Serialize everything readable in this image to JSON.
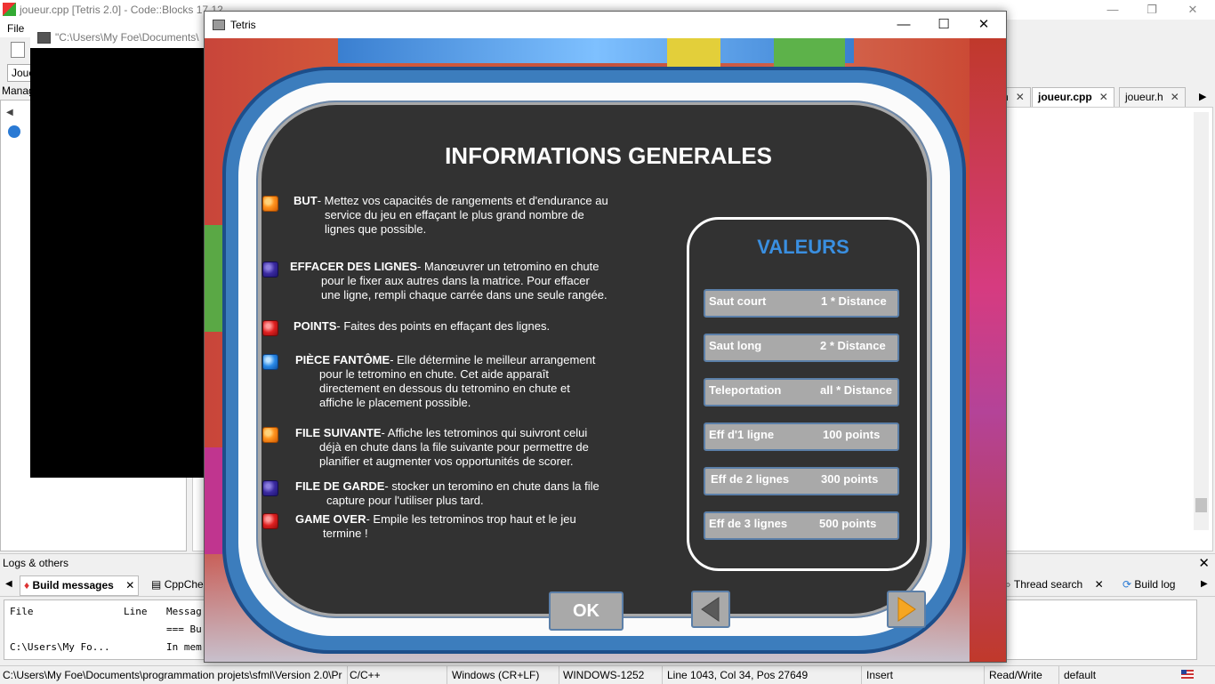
{
  "codeblocks": {
    "window_title": "joueur.cpp [Tetris 2.0] - Code::Blocks 17.12",
    "menu_file": "File",
    "manager_label": "Manag",
    "toolbar2_label": "Joue",
    "tabs": [
      {
        "label": "n"
      },
      {
        "label": "joueur.cpp"
      },
      {
        "label": "joueur.h"
      }
    ],
    "logs_title": "Logs & others",
    "log_tabs": [
      "Build messages",
      "CppChec",
      "Thread search",
      "Build log"
    ],
    "log_headers": {
      "file": "File",
      "line": "Line",
      "message": "Messag"
    },
    "log_rows": [
      {
        "file": "",
        "line": "",
        "message": "=== Bu"
      },
      {
        "file": "C:\\Users\\My Fo...",
        "line": "",
        "message": "In mem"
      }
    ],
    "status": {
      "path": "C:\\Users\\My Foe\\Documents\\programmation projets\\sfml\\Version 2.0\\Pr",
      "language": "C/C++",
      "eol": "Windows (CR+LF)",
      "encoding": "WINDOWS-1252",
      "position": "Line 1043, Col 34, Pos 27649",
      "mode": "Insert",
      "access": "Read/Write",
      "profile": "default"
    }
  },
  "console": {
    "title": "\"C:\\Users\\My Foe\\Documents\\"
  },
  "tetris": {
    "window_title": "Tetris",
    "heading": "INFORMATIONS GENERALES",
    "rules": [
      {
        "gem": "orange",
        "name": "BUT",
        "first": "- Mettez vos capacités de rangements et d'endurance au",
        "rest": [
          "service du jeu en effaçant le plus grand nombre de",
          "lignes que possible."
        ]
      },
      {
        "gem": "purple",
        "name": "EFFACER DES LIGNES",
        "first": "- Manœuvrer un tetromino en chute",
        "rest": [
          "pour le fixer aux autres dans la matrice. Pour effacer",
          "une ligne, rempli chaque carrée dans une seule rangée."
        ]
      },
      {
        "gem": "red",
        "name": "POINTS",
        "first": "- Faites des points en effaçant des lignes.",
        "rest": []
      },
      {
        "gem": "blue",
        "name": "PIÈCE FANTÔME",
        "first": "- Elle détermine le meilleur arrangement",
        "rest": [
          "pour le tetromino en chute. Cet aide apparaît",
          "directement en dessous du tetromino en chute et",
          "affiche le placement possible."
        ]
      },
      {
        "gem": "orange",
        "name": "FILE SUIVANTE",
        "first": "- Affiche les tetrominos qui suivront celui",
        "rest": [
          "déjà en chute dans la file suivante pour permettre de",
          "planifier et augmenter vos opportunités de scorer."
        ]
      },
      {
        "gem": "purple",
        "name": "FILE DE GARDE",
        "first": "- stocker un teromino en chute dans la file",
        "rest": [
          "capture pour l'utiliser plus tard."
        ]
      },
      {
        "gem": "red",
        "name": "GAME OVER",
        "first": "- Empile les tetrominos trop haut et le jeu",
        "rest": [
          "termine !"
        ]
      }
    ],
    "values_title": "VALEURS",
    "values": [
      {
        "key": "Saut court",
        "value": "1 * Distance"
      },
      {
        "key": "Saut long",
        "value": "2 * Distance"
      },
      {
        "key": "Teleportation",
        "value": "all * Distance"
      },
      {
        "key": "Eff d'1 ligne",
        "value": "100 points"
      },
      {
        "key": "Eff de 2 lignes",
        "value": "300 points"
      },
      {
        "key": "Eff de 3 lignes",
        "value": "500 points"
      }
    ],
    "ok_label": "OK",
    "colors": {
      "panel": "#323232",
      "frame_blue": "#3c7dbd",
      "values_title": "#3a8fe0",
      "arrow_left": "#5a5a5a",
      "arrow_right": "#f5a623"
    }
  }
}
